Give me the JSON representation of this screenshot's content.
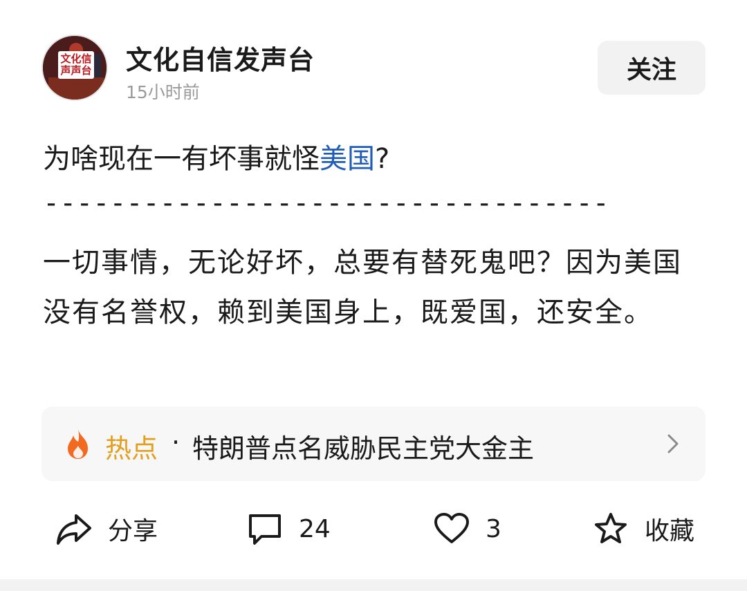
{
  "author": {
    "name": "文化自信发声台",
    "avatar_text": "文化信\n声声台",
    "time": "15小时前"
  },
  "follow_label": "关注",
  "post": {
    "title_prefix": "为啥现在一有坏事就怪",
    "title_link": "美国",
    "title_suffix": "?",
    "divider": "-----------------------------------",
    "body": "一切事情，无论好坏，总要有替死鬼吧？因为美国没有名誉权，赖到美国身上，既爱国，还安全。"
  },
  "hot_topic": {
    "label": "热点",
    "separator": "·",
    "title": "特朗普点名威胁民主党大金主",
    "icon": "flame-icon",
    "accent": "#e39f1e",
    "flame_color": "#f26a21"
  },
  "actions": {
    "share_label": "分享",
    "comment_count": "24",
    "like_count": "3",
    "favorite_label": "收藏"
  },
  "colors": {
    "link": "#1f5db8",
    "muted": "#9a9a9a",
    "text": "#1a1a1a"
  }
}
